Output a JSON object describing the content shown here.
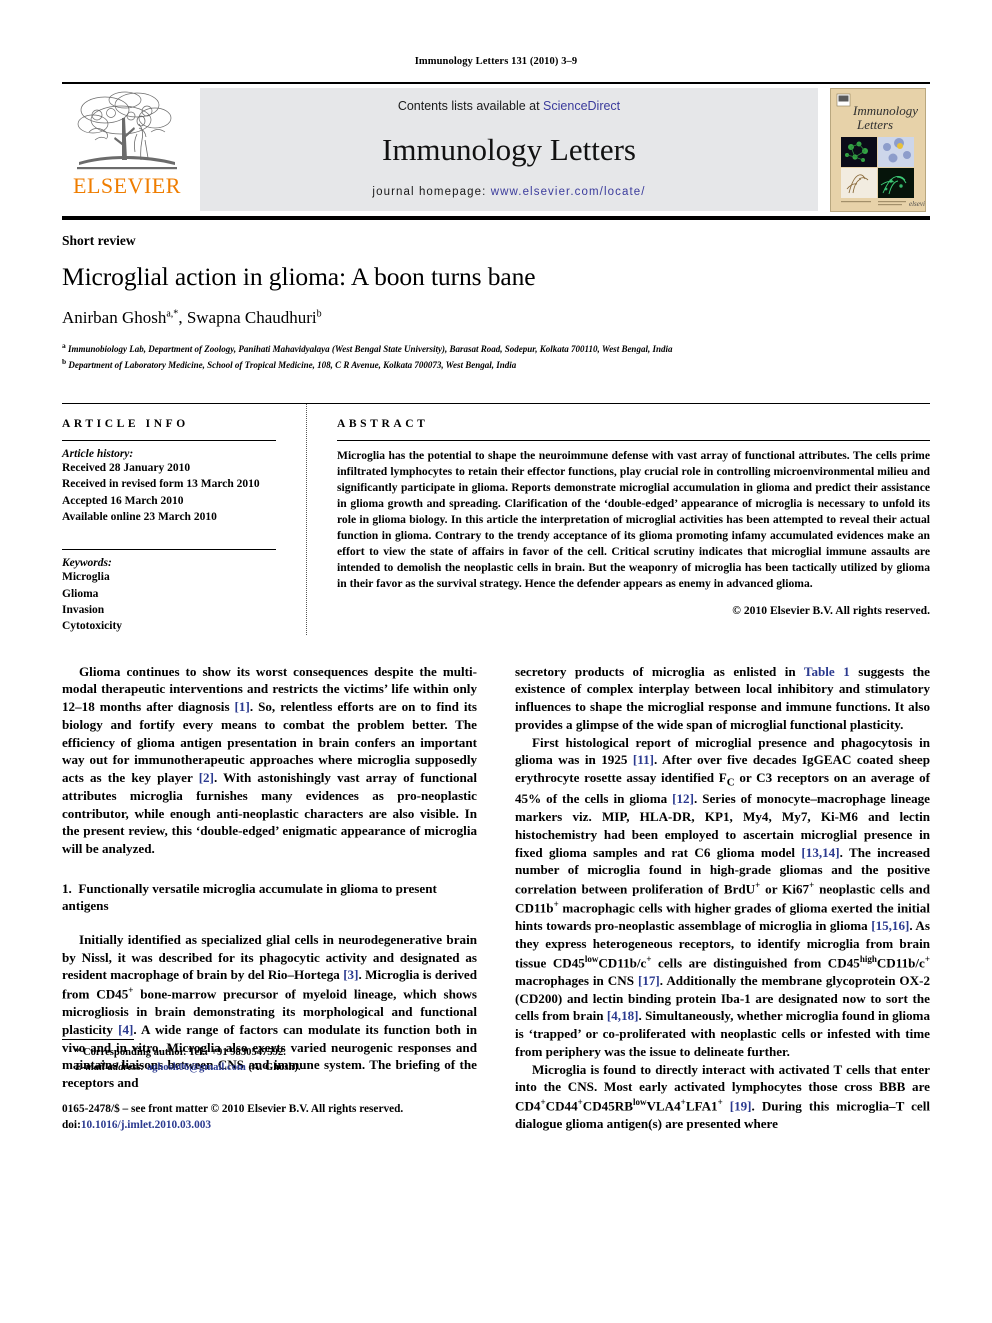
{
  "running_head": "Immunology Letters 131 (2010) 3–9",
  "masthead": {
    "contents_prefix": "Contents lists available at ",
    "contents_link": "ScienceDirect",
    "journal_title": "Immunology Letters",
    "homepage_prefix": "journal homepage: ",
    "homepage_link": "www.elsevier.com/locate/",
    "publisher_wordmark": "ELSEVIER",
    "logo_icon": "elsevier-tree-logo",
    "cover_icon": "journal-cover-thumbnail",
    "accent_orange": "#ef7d00",
    "link_blue": "#3b3b9c",
    "band_gray": "#e6e7e9"
  },
  "article": {
    "doctype": "Short review",
    "title": "Microglial action in glioma: A boon turns bane",
    "authors_html": "Anirban Ghosh<sup>a,*</sup>, Swapna Chaudhuri<sup>b</sup>",
    "affiliations": [
      "Immunobiology Lab, Department of Zoology, Panihati Mahavidyalaya (West Bengal State University), Barasat Road, Sodepur, Kolkata 700110, West Bengal, India",
      "Department of Laboratory Medicine, School of Tropical Medicine, 108, C R Avenue, Kolkata 700073, West Bengal, India"
    ],
    "affiliation_marks": [
      "a",
      "b"
    ]
  },
  "info": {
    "heading": "ARTICLE INFO",
    "history_label": "Article history:",
    "history": [
      "Received 28 January 2010",
      "Received in revised form 13 March 2010",
      "Accepted 16 March 2010",
      "Available online 23 March 2010"
    ],
    "keywords_label": "Keywords:",
    "keywords": [
      "Microglia",
      "Glioma",
      "Invasion",
      "Cytotoxicity"
    ]
  },
  "abstract": {
    "heading": "ABSTRACT",
    "text": "Microglia has the potential to shape the neuroimmune defense with vast array of functional attributes. The cells prime infiltrated lymphocytes to retain their effector functions, play crucial role in controlling microenvironmental milieu and significantly participate in glioma. Reports demonstrate microglial accumulation in glioma and predict their assistance in glioma growth and spreading. Clarification of the ‘double-edged’ appearance of microglia is necessary to unfold its role in glioma biology. In this article the interpretation of microglial activities has been attempted to reveal their actual function in glioma. Contrary to the trendy acceptance of its glioma promoting infamy accumulated evidences make an effort to view the state of affairs in favor of the cell. Critical scrutiny indicates that microglial immune assaults are intended to demolish the neoplastic cells in brain. But the weaponry of microglia has been tactically utilized by glioma in their favor as the survival strategy. Hence the defender appears as enemy in advanced glioma.",
    "copyright": "© 2010 Elsevier B.V. All rights reserved."
  },
  "body": {
    "left": {
      "para1_html": "Glioma continues to show its worst consequences despite the multi-modal therapeutic interventions and restricts the victims’ life within only 12–18 months after diagnosis <span class=\"ref\">[1]</span>. So, relentless efforts are on to find its biology and fortify every means to combat the problem better. The efficiency of glioma antigen presentation in brain confers an important way out for immunotherapeutic approaches where microglia supposedly acts as the key player <span class=\"ref\">[2]</span>. With astonishingly vast array of functional attributes microglia furnishes many evidences as pro-neoplastic contributor, while enough anti-neoplastic characters are also visible. In the present review, this ‘double-edged’ enigmatic appearance of microglia will be analyzed.",
      "section_number": "1.",
      "section_title": "Functionally versatile microglia accumulate in glioma to present antigens",
      "para2_html": "Initially identified as specialized glial cells in neurodegenerative brain by Nissl, it was described for its phagocytic activity and designated as resident macrophage of brain by del Rio–Hortega <span class=\"ref\">[3]</span>. Microglia is derived from CD45<sup class=\"inline\">+</sup> bone-marrow precursor of myeloid lineage, which shows microgliosis in brain demonstrating its morphological and functional plasticity <span class=\"ref\">[4]</span>. A wide range of factors can modulate its function both in vivo and in vitro. Microglia also exerts varied neurogenic responses and maintains liaisons between CNS and immune system. The briefing of the receptors and"
    },
    "right": {
      "para1_html": "secretory products of microglia as enlisted in <span class=\"xlink\">Table 1</span> suggests the existence of complex interplay between local inhibitory and stimulatory influences to shape the microglial response and immune functions. It also provides a glimpse of the wide span of microglial functional plasticity.",
      "para2_html": "First histological report of microglial presence and phagocytosis in glioma was in 1925 <span class=\"ref\">[11]</span>. After over five decades IgGEAC coated sheep erythrocyte rosette assay identified F<sub>C</sub> or C3 receptors on an average of 45% of the cells in glioma <span class=\"ref\">[12]</span>. Series of monocyte–macrophage lineage markers viz. MIP, HLA-DR, KP1, My4, My7, Ki-M6 and lectin histochemistry had been employed to ascertain microglial presence in fixed glioma samples and rat C6 glioma model <span class=\"ref\">[13,14]</span>. The increased number of microglia found in high-grade gliomas and the positive correlation between proliferation of BrdU<sup class=\"inline\">+</sup> or Ki67<sup class=\"inline\">+</sup> neoplastic cells and CD11b<sup class=\"inline\">+</sup> macrophagic cells with higher grades of glioma exerted the initial hints towards pro-neoplastic assemblage of microglia in glioma <span class=\"ref\">[15,16]</span>. As they express heterogeneous receptors, to identify microglia from brain tissue CD45<sup class=\"inline\">low</sup>CD11b/c<sup class=\"inline\">+</sup> cells are distinguished from CD45<sup class=\"inline\">high</sup>CD11b/c<sup class=\"inline\">+</sup> macrophages in CNS <span class=\"ref\">[17]</span>. Additionally the membrane glycoprotein OX-2 (CD200) and lectin binding protein Iba-1 are designated now to sort the cells from brain <span class=\"ref\">[4,18]</span>. Simultaneously, whether microglia found in glioma is ‘trapped’ or co-proliferated with neoplastic cells or infested with time from periphery was the issue to delineate further.",
      "para3_html": "Microglia is found to directly interact with activated T cells that enter into the CNS. Most early activated lymphocytes those cross BBB are CD4<sup class=\"inline\">+</sup>CD44<sup class=\"inline\">+</sup>CD45RB<sup class=\"inline\">low</sup>VLA4<sup class=\"inline\">+</sup>LFA1<sup class=\"inline\">+</sup> <span class=\"ref\">[19]</span>. During this microglia–T cell dialogue glioma antigen(s) are presented where"
    }
  },
  "footnotes": {
    "corresponding_html": "* Corresponding author. Tel.: +91 9830547592.",
    "email_html": "<span class=\"ital\">E-mail address:</span> <span class=\"xlink\">aghosh06@gmail.com</span> (A. Ghosh)."
  },
  "imprint": {
    "line1_html": "0165-2478/$ – see front matter © 2010 Elsevier B.V. All rights reserved.",
    "line2_html": "doi:<span class=\"xlink\">10.1016/j.imlet.2010.03.003</span>"
  }
}
